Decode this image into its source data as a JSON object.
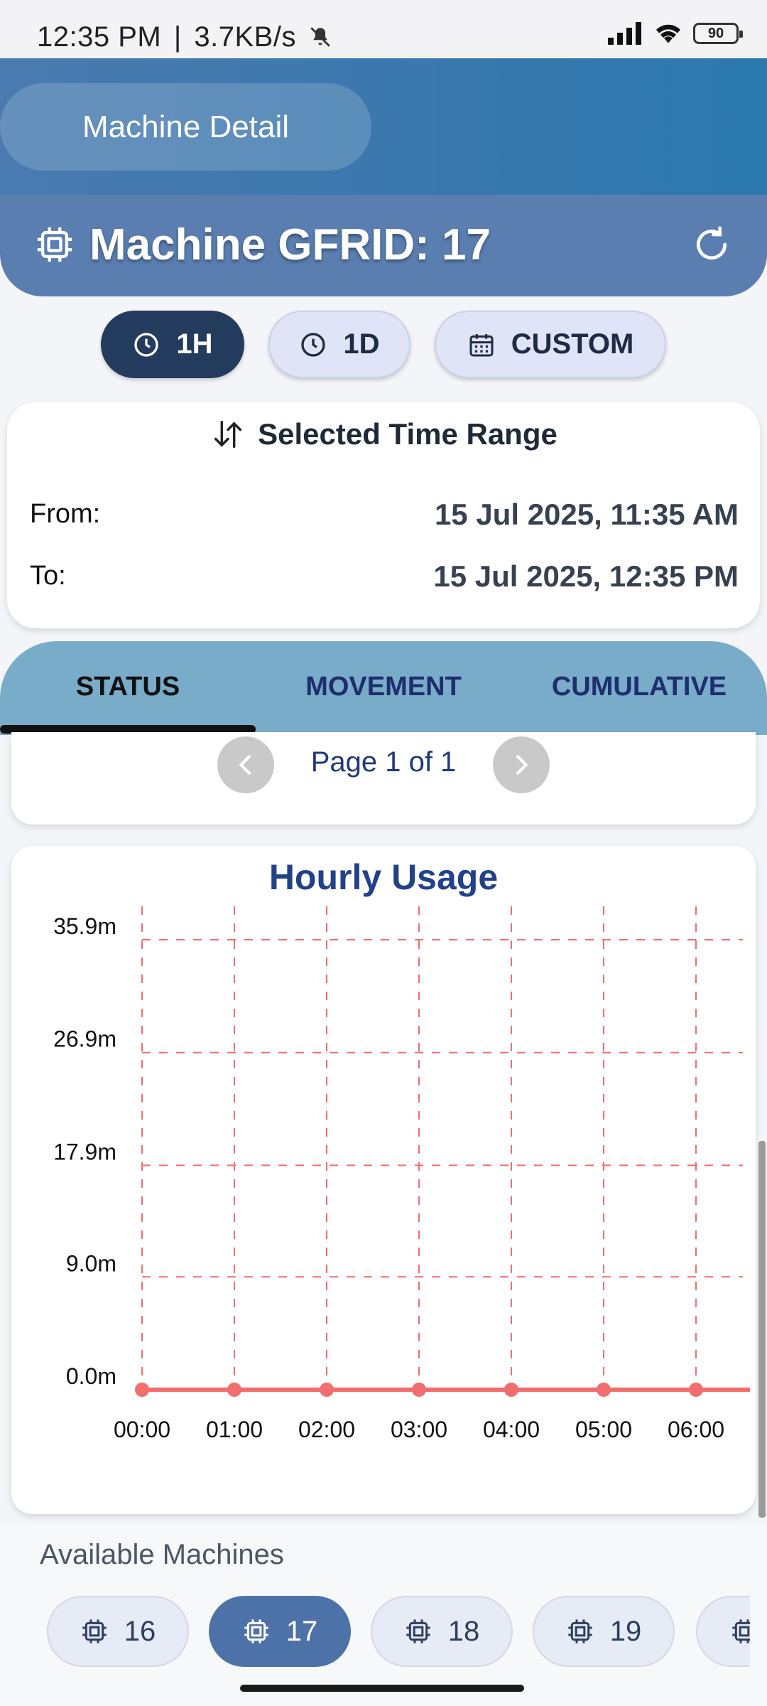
{
  "status_bar": {
    "time": "12:35 PM",
    "network_speed": "3.7KB/s",
    "battery": "90",
    "icons": [
      "mute-icon",
      "signal-icon",
      "wifi-icon",
      "battery-icon"
    ]
  },
  "header": {
    "screen_title": "Machine Detail",
    "machine_title": "Machine GFRID: 17",
    "icons": [
      "chip-icon",
      "refresh-icon"
    ]
  },
  "range_buttons": [
    {
      "label": "1H",
      "icon": "clock-icon",
      "active": true
    },
    {
      "label": "1D",
      "icon": "clock-icon",
      "active": false
    },
    {
      "label": "CUSTOM",
      "icon": "calendar-icon",
      "active": false
    }
  ],
  "time_range": {
    "title": "Selected Time Range",
    "from_label": "From:",
    "from_value": "15 Jul 2025, 11:35 AM",
    "to_label": "To:",
    "to_value": "15 Jul 2025, 12:35 PM"
  },
  "tabs": [
    {
      "label": "STATUS",
      "active": true
    },
    {
      "label": "MOVEMENT",
      "active": false
    },
    {
      "label": "CUMULATIVE",
      "active": false
    }
  ],
  "pager": {
    "text": "Page 1 of 1"
  },
  "chart_data": {
    "type": "line",
    "title": "Hourly Usage",
    "categories": [
      "00:00",
      "01:00",
      "02:00",
      "03:00",
      "04:00",
      "05:00",
      "06:00"
    ],
    "values": [
      0,
      0,
      0,
      0,
      0,
      0,
      0
    ],
    "y_tick_labels": [
      "0.0m",
      "9.0m",
      "17.9m",
      "26.9m",
      "35.9m"
    ],
    "y_ticks": [
      0,
      9.0,
      17.9,
      26.9,
      35.9
    ],
    "ylim": [
      0,
      35.9
    ],
    "grid": true,
    "color": "#f26d6d"
  },
  "machines": {
    "label": "Available Machines",
    "items": [
      {
        "label": "16",
        "active": false
      },
      {
        "label": "17",
        "active": true
      },
      {
        "label": "18",
        "active": false
      },
      {
        "label": "19",
        "active": false
      }
    ]
  },
  "colors": {
    "header_blue": "#4a7bb0",
    "active_dark": "#233b5c",
    "tab_bar": "#79acc8",
    "chart_line": "#f26d6d",
    "title_blue": "#21418a"
  }
}
